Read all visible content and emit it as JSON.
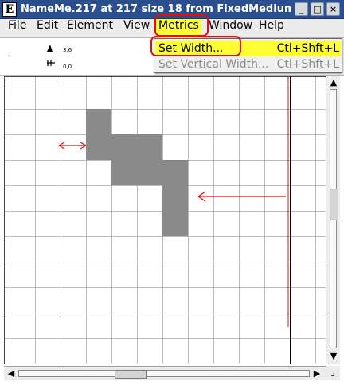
{
  "window": {
    "app_icon": "E",
    "title": "NameMe.217 at 217 size 18 from FixedMedium",
    "minimize_label": "_",
    "maximize_label": "□",
    "close_label": "×"
  },
  "menubar": {
    "items": [
      {
        "label": "File"
      },
      {
        "label": "Edit"
      },
      {
        "label": "Element"
      },
      {
        "label": "View"
      },
      {
        "label": "Metrics"
      },
      {
        "label": "Window"
      },
      {
        "label": "Help"
      }
    ],
    "open_menu": "Metrics"
  },
  "toolbar": {
    "coord_top": "3,6",
    "coord_bottom": "0,0"
  },
  "dropdown": {
    "items": [
      {
        "label": "Set Width...",
        "shortcut": "Ctl+Shft+L",
        "enabled": true,
        "active": true
      },
      {
        "label": "Set Vertical Width...",
        "shortcut": "Ctl+Shft+L",
        "enabled": false,
        "active": false
      }
    ]
  },
  "colors": {
    "highlight": "#ffff33",
    "annotation_red": "#e01010",
    "pixel_fill": "#8a8a8a",
    "titlebar": "#2b4f8e"
  },
  "icons": {
    "pointer": "pointer-icon",
    "magnify": "magnify-icon",
    "close": "close-icon"
  }
}
